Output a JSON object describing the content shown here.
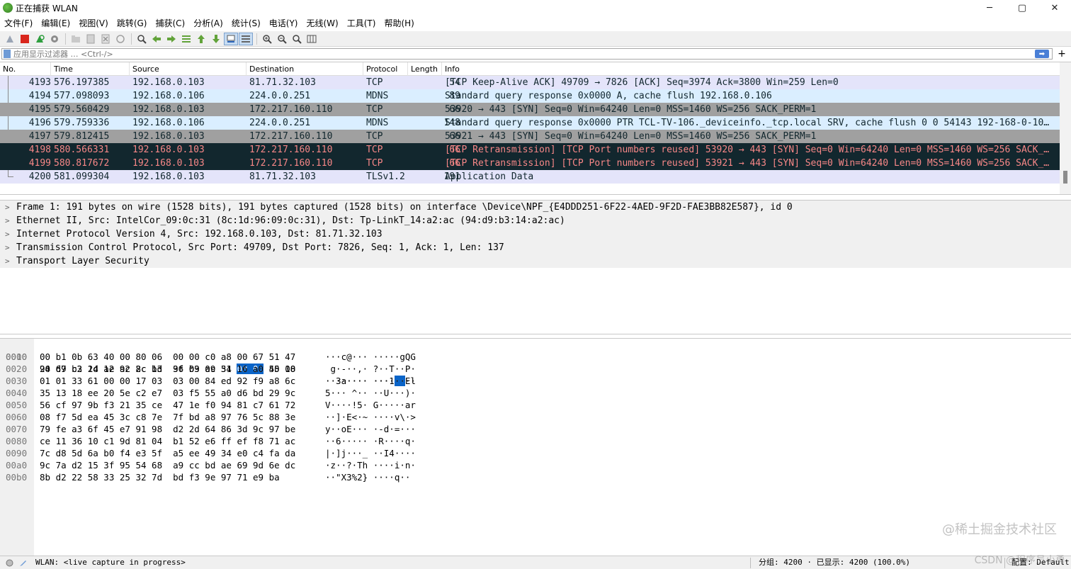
{
  "window": {
    "title": "正在捕获 WLAN",
    "minimize": "─",
    "maximize": "▢",
    "close": "✕"
  },
  "menu": [
    "文件(F)",
    "编辑(E)",
    "视图(V)",
    "跳转(G)",
    "捕获(C)",
    "分析(A)",
    "统计(S)",
    "电话(Y)",
    "无线(W)",
    "工具(T)",
    "帮助(H)"
  ],
  "toolbar_icons": [
    "shark-fin-icon",
    "stop-icon",
    "restart-icon",
    "options-gear-icon",
    "open-folder-icon",
    "save-icon",
    "close-file-icon",
    "reload-icon",
    "find-icon",
    "back-arrow-icon",
    "forward-arrow-icon",
    "go-to-packet-icon",
    "first-packet-icon",
    "last-packet-icon",
    "autoscroll-icon",
    "colorize-icon",
    "zoom-in-icon",
    "zoom-out-icon",
    "zoom-normal-icon",
    "resize-columns-icon"
  ],
  "filter": {
    "placeholder": "应用显示过滤器 … <Ctrl-/>",
    "value": "",
    "apply_symbol": "➡",
    "add_symbol": "+"
  },
  "packet_list": {
    "columns": [
      "No.",
      "Time",
      "Source",
      "Destination",
      "Protocol",
      "Length",
      "Info"
    ],
    "rows": [
      {
        "no": "4193",
        "time": "576.197385",
        "src": "192.168.0.103",
        "dst": "81.71.32.103",
        "proto": "TCP",
        "len": "54",
        "info": "[TCP Keep-Alive ACK] 49709 → 7826 [ACK] Seq=3974 Ack=3800 Win=259 Len=0",
        "bg": "#e4e4fa",
        "fg": "#12272e",
        "marker": "line"
      },
      {
        "no": "4194",
        "time": "577.098093",
        "src": "192.168.0.106",
        "dst": "224.0.0.251",
        "proto": "MDNS",
        "len": "89",
        "info": "Standard query response 0x0000 A, cache flush 192.168.0.106",
        "bg": "#daeeff",
        "fg": "#12272e",
        "marker": "line"
      },
      {
        "no": "4195",
        "time": "579.560429",
        "src": "192.168.0.103",
        "dst": "172.217.160.110",
        "proto": "TCP",
        "len": "66",
        "info": "53920 → 443 [SYN] Seq=0 Win=64240 Len=0 MSS=1460 WS=256 SACK_PERM=1",
        "bg": "#a0a0a0",
        "fg": "#12272e",
        "marker": "none"
      },
      {
        "no": "4196",
        "time": "579.759336",
        "src": "192.168.0.106",
        "dst": "224.0.0.251",
        "proto": "MDNS",
        "len": "148",
        "info": "Standard query response 0x0000 PTR TCL-TV-106._deviceinfo._tcp.local SRV, cache flush 0 0 54143 192-168-0-10…",
        "bg": "#daeeff",
        "fg": "#12272e",
        "marker": "line"
      },
      {
        "no": "4197",
        "time": "579.812415",
        "src": "192.168.0.103",
        "dst": "172.217.160.110",
        "proto": "TCP",
        "len": "66",
        "info": "53921 → 443 [SYN] Seq=0 Win=64240 Len=0 MSS=1460 WS=256 SACK_PERM=1",
        "bg": "#a0a0a0",
        "fg": "#12272e",
        "marker": "none"
      },
      {
        "no": "4198",
        "time": "580.566331",
        "src": "192.168.0.103",
        "dst": "172.217.160.110",
        "proto": "TCP",
        "len": "66",
        "info": "[TCP Retransmission] [TCP Port numbers reused] 53920 → 443 [SYN] Seq=0 Win=64240 Len=0 MSS=1460 WS=256 SACK_…",
        "bg": "#12272e",
        "fg": "#f78787",
        "marker": "none"
      },
      {
        "no": "4199",
        "time": "580.817672",
        "src": "192.168.0.103",
        "dst": "172.217.160.110",
        "proto": "TCP",
        "len": "66",
        "info": "[TCP Retransmission] [TCP Port numbers reused] 53921 → 443 [SYN] Seq=0 Win=64240 Len=0 MSS=1460 WS=256 SACK_…",
        "bg": "#12272e",
        "fg": "#f78787",
        "marker": "none"
      },
      {
        "no": "4200",
        "time": "581.099304",
        "src": "192.168.0.103",
        "dst": "81.71.32.103",
        "proto": "TLSv1.2",
        "len": "191",
        "info": "Application Data",
        "bg": "#e4e4fa",
        "fg": "#12272e",
        "marker": "end"
      }
    ]
  },
  "details": [
    "Frame 1: 191 bytes on wire (1528 bits), 191 bytes captured (1528 bits) on interface \\Device\\NPF_{E4DDD251-6F22-4AED-9F2D-FAE3BB82E587}, id 0",
    "Ethernet II, Src: IntelCor_09:0c:31 (8c:1d:96:09:0c:31), Dst: Tp-LinkT_14:a2:ac (94:d9:b3:14:a2:ac)",
    "Internet Protocol Version 4, Src: 192.168.0.103, Dst: 81.71.32.103",
    "Transmission Control Protocol, Src Port: 49709, Dst Port: 7826, Seq: 1, Ack: 1, Len: 137",
    "Transport Layer Security"
  ],
  "bytes": [
    {
      "off": "0000",
      "hex_a": "94 d9 b3 14 a2 ac 8c 1d  96 09 0c 31 ",
      "hex_hl": "08 00",
      "hex_b": " 45 00",
      "asc_a": "········ ···1",
      "asc_hl": "··",
      "asc_b": "E·"
    },
    {
      "off": "0010",
      "hex": "00 b1 0b 63 40 00 80 06  00 00 c0 a8 00 67 51 47",
      "asc": "···c@··· ·····gQG"
    },
    {
      "off": "0020",
      "hex": "20 67 c2 2d 1e 92 2c b3  3f b3 a9 54 16 a0 50 18",
      "asc": " g·-··,· ?··T··P·"
    },
    {
      "off": "0030",
      "hex": "01 01 33 61 00 00 17 03  03 00 84 ed 92 f9 a8 6c",
      "asc": "··3a···· ·······l"
    },
    {
      "off": "0040",
      "hex": "35 13 18 ee 20 5e c2 e7  03 f5 55 a0 d6 bd 29 9c",
      "asc": "5··· ^·· ··U···)·"
    },
    {
      "off": "0050",
      "hex": "56 cf 97 9b f3 21 35 ce  47 1e f0 94 81 c7 61 72",
      "asc": "V····!5· G·····ar"
    },
    {
      "off": "0060",
      "hex": "08 f7 5d ea 45 3c c8 7e  7f bd a8 97 76 5c 88 3e",
      "asc": "··]·E<·~ ····v\\·>"
    },
    {
      "off": "0070",
      "hex": "79 fe a3 6f 45 e7 91 98  d2 2d 64 86 3d 9c 97 be",
      "asc": "y··oE··· ·-d·=···"
    },
    {
      "off": "0080",
      "hex": "ce 11 36 10 c1 9d 81 04  b1 52 e6 ff ef f8 71 ac",
      "asc": "··6····· ·R····q·"
    },
    {
      "off": "0090",
      "hex": "7c d8 5d 6a b0 f4 e3 5f  a5 ee 49 34 e0 c4 fa da",
      "asc": "|·]j···_ ··I4····"
    },
    {
      "off": "00a0",
      "hex": "9c 7a d2 15 3f 95 54 68  a9 cc bd ae 69 9d 6e dc",
      "asc": "·z··?·Th ····i·n·"
    },
    {
      "off": "00b0",
      "hex": "8b d2 22 58 33 25 32 7d  bd f3 9e 97 71 e9 ba",
      "asc": "··\"X3%2} ····q··"
    }
  ],
  "status": {
    "capture": "WLAN: <live capture in progress>",
    "packets": "分组: 4200 · 已显示: 4200 (100.0%)",
    "profile": "配置: Default"
  },
  "watermark": "@稀土掘金技术社区",
  "watermark2": "CSDN @程序员小勇",
  "colors": {
    "selected_bytes": "#0a64c8",
    "tcp_syn_row": "#a0a0a0",
    "retransmission_row_bg": "#12272e",
    "retransmission_row_fg": "#f78787",
    "tcp_row": "#e4e4fa",
    "udp_row": "#daeeff"
  }
}
